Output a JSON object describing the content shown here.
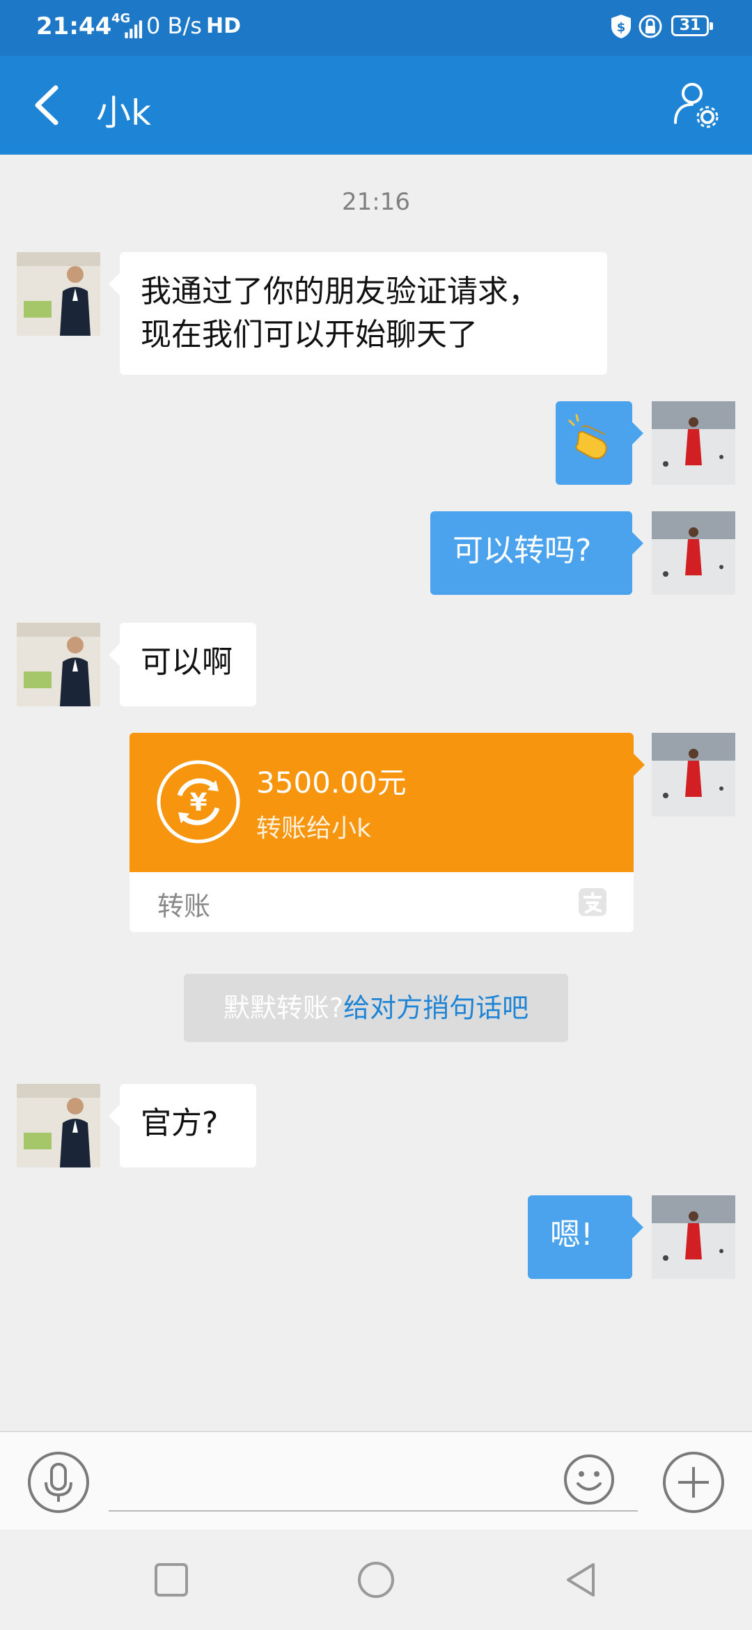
{
  "status_bar": {
    "time": "21:44",
    "network": "4G",
    "speed": "0 B/s",
    "hd": "HD",
    "battery": "31"
  },
  "header": {
    "title": "小k"
  },
  "chat": {
    "timestamp": "21:16",
    "messages": [
      {
        "side": "in",
        "text": "我通过了你的朋友验证请求，\n现在我们可以开始聊天了"
      },
      {
        "side": "out",
        "text": "👏",
        "icon": "clapping-hands-emoji"
      },
      {
        "side": "out",
        "text": "可以转吗?"
      },
      {
        "side": "in",
        "text": "可以啊"
      },
      {
        "side": "in",
        "text": "官方?"
      },
      {
        "side": "out",
        "text": "嗯!"
      }
    ],
    "transfer": {
      "amount": "3500.00元",
      "description": "转账给小k",
      "label": "转账"
    },
    "prompt": {
      "prefix": "默默转账?",
      "link": "给对方捎句话吧"
    }
  },
  "input": {
    "placeholder": ""
  },
  "colors": {
    "header": "#1e84d5",
    "outgoing_bubble": "#4ba3ed",
    "transfer_card": "#f7950f"
  }
}
